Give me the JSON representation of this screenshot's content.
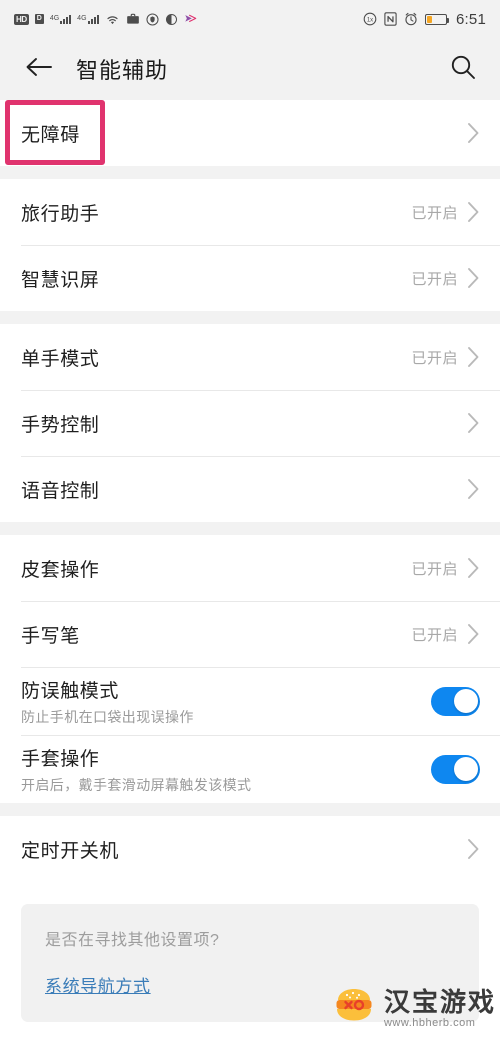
{
  "statusbar": {
    "icons_left": [
      "hd-icon",
      "sim-data-icon",
      "signal-4g-sim1-icon",
      "signal-4g-sim2-icon",
      "wifi-icon",
      "briefcase-icon",
      "shield-icon",
      "sync-icon",
      "share-icon"
    ],
    "hd_label": "HD",
    "sim_label": "D",
    "network_label_1": "4G",
    "network_label_2": "4G",
    "icons_right": [
      "data-saver-icon",
      "nfc-icon",
      "alarm-icon",
      "battery-icon"
    ],
    "time": "6:51"
  },
  "appbar": {
    "back_icon": "back-arrow-icon",
    "title": "智能辅助",
    "search_icon": "search-icon"
  },
  "highlight": {
    "color": "#e0336e",
    "target": "无障碍"
  },
  "groups": [
    {
      "rows": [
        {
          "title": "无障碍",
          "sub": "",
          "value": "",
          "control": "chevron"
        }
      ]
    },
    {
      "rows": [
        {
          "title": "旅行助手",
          "sub": "",
          "value": "已开启",
          "control": "chevron"
        },
        {
          "title": "智慧识屏",
          "sub": "",
          "value": "已开启",
          "control": "chevron"
        }
      ]
    },
    {
      "rows": [
        {
          "title": "单手模式",
          "sub": "",
          "value": "已开启",
          "control": "chevron"
        },
        {
          "title": "手势控制",
          "sub": "",
          "value": "",
          "control": "chevron"
        },
        {
          "title": "语音控制",
          "sub": "",
          "value": "",
          "control": "chevron"
        }
      ]
    },
    {
      "rows": [
        {
          "title": "皮套操作",
          "sub": "",
          "value": "已开启",
          "control": "chevron"
        },
        {
          "title": "手写笔",
          "sub": "",
          "value": "已开启",
          "control": "chevron"
        },
        {
          "title": "防误触模式",
          "sub": "防止手机在口袋出现误操作",
          "value": "",
          "control": "toggle",
          "toggle_on": true
        },
        {
          "title": "手套操作",
          "sub": "开启后，戴手套滑动屏幕触发该模式",
          "value": "",
          "control": "toggle",
          "toggle_on": true
        }
      ]
    },
    {
      "rows": [
        {
          "title": "定时开关机",
          "sub": "",
          "value": "",
          "control": "chevron"
        }
      ]
    }
  ],
  "hint_card": {
    "question": "是否在寻找其他设置项?",
    "link": "系统导航方式"
  },
  "watermark": {
    "logo_icon": "burger-logo-icon",
    "name": "汉宝游戏",
    "url": "www.hbherb.com"
  },
  "colors": {
    "toggle_on": "#0e87f0",
    "link": "#3a7cb8",
    "highlight": "#e0336e",
    "battery_low": "#f5a623"
  }
}
